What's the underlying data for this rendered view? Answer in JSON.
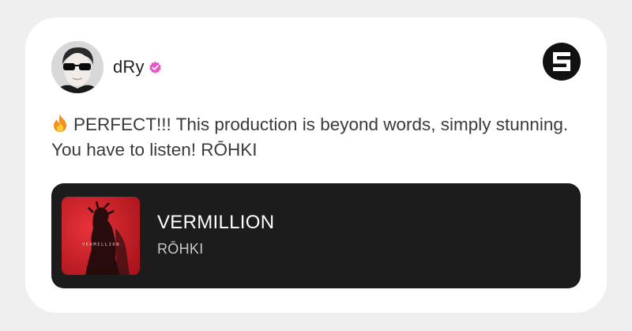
{
  "post": {
    "user": {
      "name": "dRy",
      "verified": true,
      "verified_badge_color": "#e05bc6",
      "avatar_icon": "user-avatar"
    },
    "platform_icon": "sound-s-logo",
    "emoji": "fire-emoji",
    "text": "PERFECT!!! This production is beyond words, simply stunning. You have to listen! RŌHKI"
  },
  "track": {
    "title": "VERMILLION",
    "artist": "RŌHKI",
    "cover_icon": "album-cover-art",
    "cover_text": "VERMILLION"
  },
  "colors": {
    "background": "#efefef",
    "card": "#ffffff",
    "track_card": "#1c1c1c",
    "cover_red": "#d4232a"
  }
}
